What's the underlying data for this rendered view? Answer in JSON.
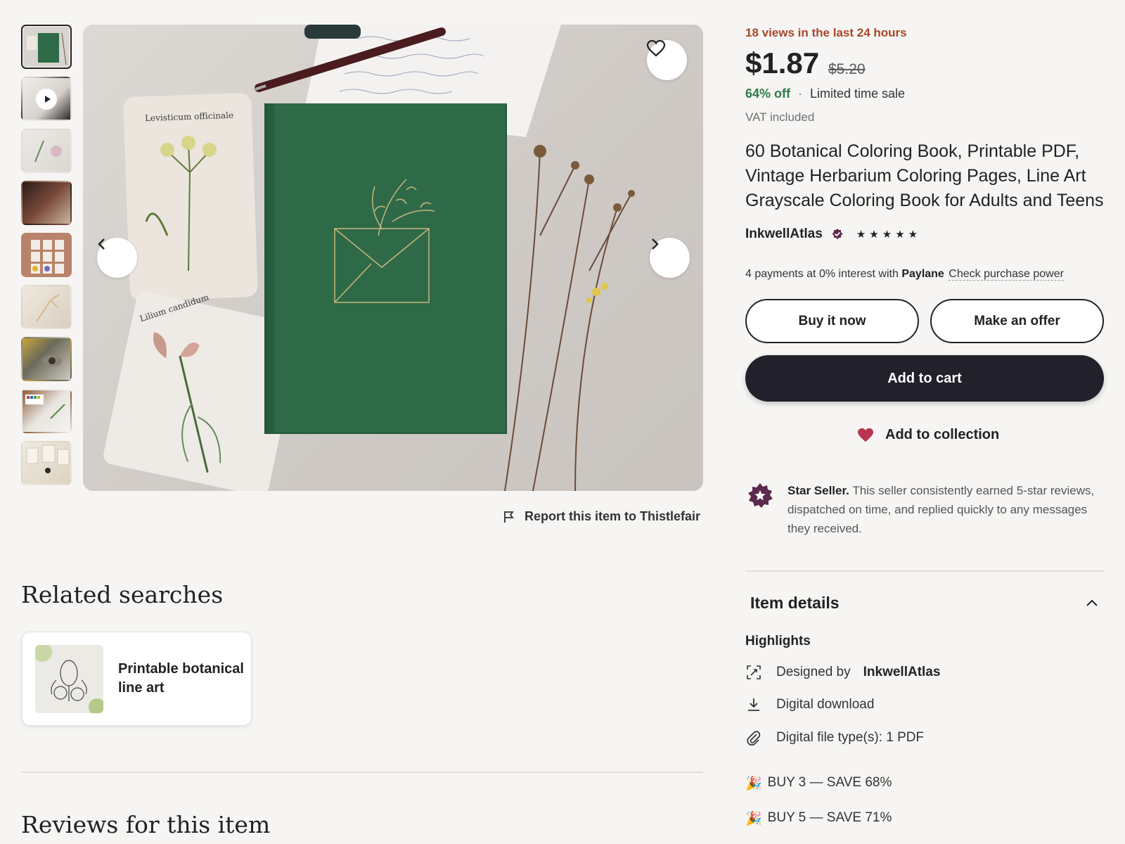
{
  "gallery": {
    "thumbnails": [
      {
        "label": "cover"
      },
      {
        "label": "video"
      },
      {
        "label": "pages"
      },
      {
        "label": "table"
      },
      {
        "label": "grid"
      },
      {
        "label": "flower"
      },
      {
        "label": "eye"
      },
      {
        "label": "paints"
      },
      {
        "label": "prints"
      }
    ],
    "main_image_alt": "green notebook with botanical cards and dried flowers"
  },
  "report": {
    "label": "Report this item to Thistlefair"
  },
  "related": {
    "title": "Related searches",
    "cards": [
      {
        "label": "Printable botanical line art"
      }
    ]
  },
  "reviews": {
    "title": "Reviews for this item"
  },
  "listing": {
    "views_text": "18 views in the last 24 hours",
    "price": "$1.87",
    "original_price": "$5.20",
    "discount": "64% off",
    "separator": "·",
    "sale_label": "Limited time sale",
    "vat": "VAT included",
    "title": "60 Botanical Coloring Book, Printable PDF, Vintage Herbarium Coloring Pages, Line Art Grayscale Coloring Book for Adults and Teens",
    "shop_name": "InkwellAtlas",
    "rating_stars": 5,
    "payments": {
      "text": "4 payments at 0% interest with",
      "provider": "Paylane",
      "link": "Check purchase power"
    },
    "buy_now": "Buy it now",
    "make_offer": "Make an offer",
    "add_to_cart": "Add to cart",
    "add_to_collection": "Add to collection",
    "star_seller": {
      "title": "Star Seller.",
      "text": "This seller consistently earned 5-star reviews, dispatched on time, and replied quickly to any messages they received."
    }
  },
  "details": {
    "heading": "Item details",
    "highlights_title": "Highlights",
    "designed_by_label": "Designed by",
    "designed_by_name": "InkwellAtlas",
    "download": "Digital download",
    "file_types": "Digital file type(s): 1 PDF",
    "promos": [
      {
        "icon": "🎉",
        "text": "BUY 3 — SAVE 68%"
      },
      {
        "icon": "🎉",
        "text": "BUY 5 — SAVE 71%"
      }
    ]
  },
  "colors": {
    "accent_dark": "#22202b",
    "views_orange": "#a7472b",
    "discount_green": "#2f7a4a",
    "heart_red": "#b9354f",
    "star_seller_purple": "#5b2a4e",
    "book_green": "#2e6a48"
  }
}
